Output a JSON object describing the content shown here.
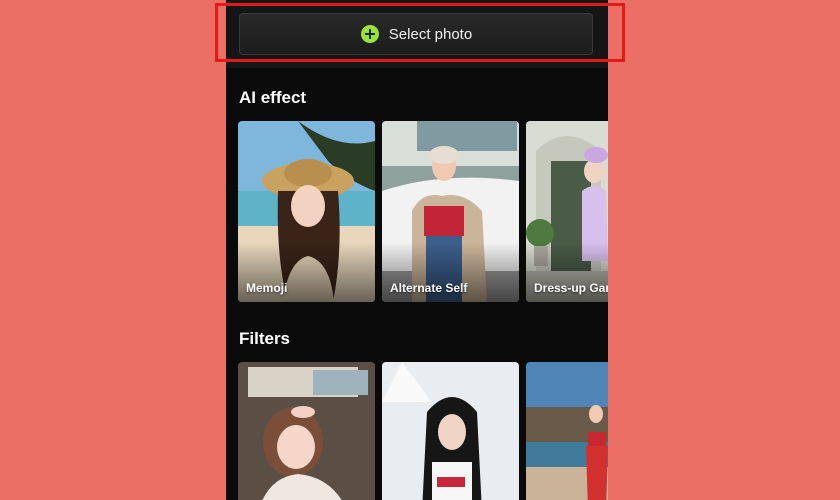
{
  "toolbar": {
    "select_photo_label": "Select photo"
  },
  "ai_effect": {
    "title": "AI effect",
    "items": [
      {
        "label": "Memoji"
      },
      {
        "label": "Alternate Self"
      },
      {
        "label": "Dress-up Gar"
      }
    ]
  },
  "filters": {
    "title": "Filters"
  },
  "colors": {
    "background": "#ec6f66",
    "panel": "#0a0a0a",
    "accent_green": "#9be33a",
    "highlight_red": "#e21a1a"
  },
  "icons": {
    "add": "plus-circle-icon"
  }
}
